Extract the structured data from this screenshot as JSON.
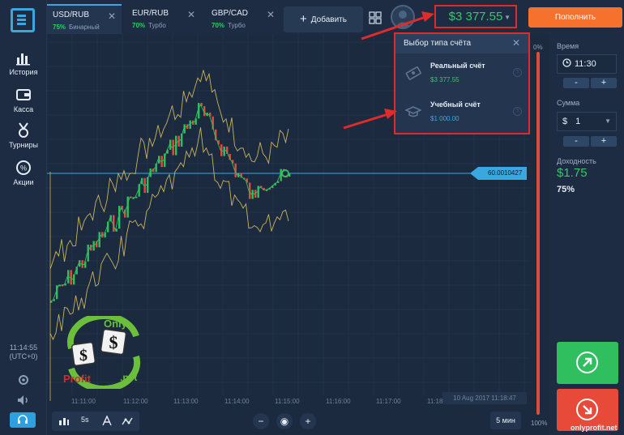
{
  "sidebar": {
    "items": [
      {
        "label": "История",
        "icon": "chart-bars-icon"
      },
      {
        "label": "Касса",
        "icon": "wallet-icon"
      },
      {
        "label": "Турниры",
        "icon": "medal-icon"
      },
      {
        "label": "Акции",
        "icon": "percent-badge-icon"
      }
    ],
    "time": "11:14:55",
    "timezone": "(UTC+0)"
  },
  "tabs": [
    {
      "name": "USD/RUB",
      "pct": "75%",
      "kind": "Бинарный",
      "active": true
    },
    {
      "name": "EUR/RUB",
      "pct": "70%",
      "kind": "Турбо",
      "active": false
    },
    {
      "name": "GBP/CAD",
      "pct": "70%",
      "kind": "Турбо",
      "active": false
    }
  ],
  "toolbar": {
    "add_label": "Добавить",
    "balance": "$3 377.55",
    "deposit_label": "Пополнить"
  },
  "popup": {
    "title": "Выбор типа счёта",
    "accounts": [
      {
        "name": "Реальный счёт",
        "amount": "$3 377.55",
        "color": "#35c96a"
      },
      {
        "name": "Учебный счёт",
        "amount": "$1 000.00",
        "color": "#3aa8e0"
      }
    ]
  },
  "chart": {
    "price_label": "60.0010427",
    "time_labels": [
      "11:11:00",
      "11:12:00",
      "11:13:00",
      "11:14:00",
      "11:15:00",
      "11:16:00",
      "11:17:00",
      "11:18:00"
    ],
    "date_label": "10 Aug 2017 11:18:47",
    "tools": {
      "timeframe": "5s"
    },
    "timeframe_button": "5 мин",
    "scale_top": "0%",
    "scale_bottom": "100%"
  },
  "right_panel": {
    "time_label": "Время",
    "time_value": "11:30",
    "amount_label": "Сумма",
    "amount_currency": "$",
    "amount_value": "1",
    "profit_label": "Доходность",
    "profit_value": "$1.75",
    "profit_pct": "75%",
    "stepper_minus": "-",
    "stepper_plus": "+"
  },
  "watermark": {
    "top": "Only",
    "bottom": "Profit",
    "suffix": ".net",
    "site": "onlyprofit.net"
  },
  "colors": {
    "accent": "#3aa8e0",
    "green": "#35c96a",
    "red": "#e84a3a",
    "orange": "#f5712c",
    "highlight": "#e02b2b"
  }
}
